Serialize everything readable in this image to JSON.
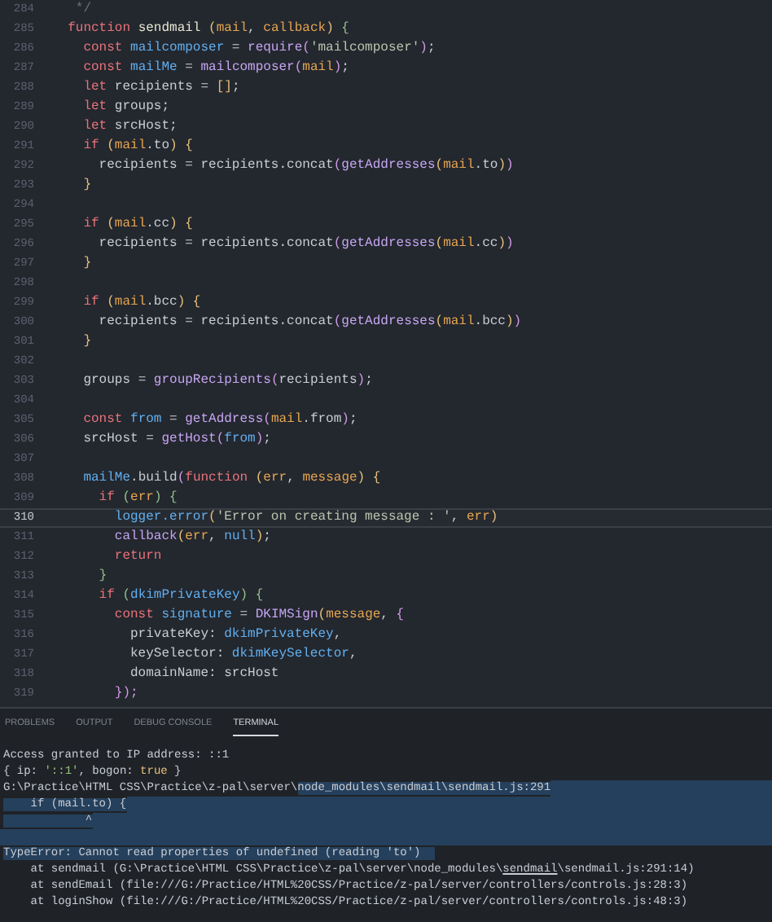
{
  "editor": {
    "lines": [
      {
        "number": "284",
        "current": false,
        "tokens": [
          {
            "text": "   */",
            "kind": "comment"
          }
        ]
      },
      {
        "number": "285",
        "current": false,
        "tokens": [
          {
            "text": "  function ",
            "kind": "kw"
          },
          {
            "text": "sendmail ",
            "kind": "fn"
          },
          {
            "text": "(",
            "kind": "b1"
          },
          {
            "text": "mail",
            "kind": "param"
          },
          {
            "text": ", ",
            "kind": "plain"
          },
          {
            "text": "callback",
            "kind": "param"
          },
          {
            "text": ") ",
            "kind": "b1"
          },
          {
            "text": "{",
            "kind": "b3"
          }
        ]
      },
      {
        "number": "286",
        "current": false,
        "tokens": [
          {
            "text": "    const ",
            "kind": "kw"
          },
          {
            "text": "mailcomposer",
            "kind": "var"
          },
          {
            "text": " = ",
            "kind": "op"
          },
          {
            "text": "require",
            "kind": "call"
          },
          {
            "text": "(",
            "kind": "b2"
          },
          {
            "text": "'mailcomposer'",
            "kind": "str"
          },
          {
            "text": ")",
            "kind": "b2"
          },
          {
            "text": ";",
            "kind": "plain"
          }
        ]
      },
      {
        "number": "287",
        "current": false,
        "tokens": [
          {
            "text": "    const ",
            "kind": "kw"
          },
          {
            "text": "mailMe",
            "kind": "var"
          },
          {
            "text": " = ",
            "kind": "op"
          },
          {
            "text": "mailcomposer",
            "kind": "call"
          },
          {
            "text": "(",
            "kind": "b2"
          },
          {
            "text": "mail",
            "kind": "param"
          },
          {
            "text": ")",
            "kind": "b2"
          },
          {
            "text": ";",
            "kind": "plain"
          }
        ]
      },
      {
        "number": "288",
        "current": false,
        "tokens": [
          {
            "text": "    let ",
            "kind": "kw"
          },
          {
            "text": "recipients",
            "kind": "plain"
          },
          {
            "text": " = ",
            "kind": "op"
          },
          {
            "text": "[]",
            "kind": "b1"
          },
          {
            "text": ";",
            "kind": "plain"
          }
        ]
      },
      {
        "number": "289",
        "current": false,
        "tokens": [
          {
            "text": "    let ",
            "kind": "kw"
          },
          {
            "text": "groups;",
            "kind": "plain"
          }
        ]
      },
      {
        "number": "290",
        "current": false,
        "tokens": [
          {
            "text": "    let ",
            "kind": "kw"
          },
          {
            "text": "srcHost;",
            "kind": "plain"
          }
        ]
      },
      {
        "number": "291",
        "current": false,
        "tokens": [
          {
            "text": "    if ",
            "kind": "kw"
          },
          {
            "text": "(",
            "kind": "b1"
          },
          {
            "text": "mail",
            "kind": "param"
          },
          {
            "text": ".to",
            "kind": "plain"
          },
          {
            "text": ") {",
            "kind": "b1"
          }
        ]
      },
      {
        "number": "292",
        "current": false,
        "tokens": [
          {
            "text": "      recipients",
            "kind": "plain"
          },
          {
            "text": " = ",
            "kind": "op"
          },
          {
            "text": "recipients.concat",
            "kind": "plain"
          },
          {
            "text": "(",
            "kind": "b2"
          },
          {
            "text": "getAddresses",
            "kind": "call"
          },
          {
            "text": "(",
            "kind": "b1"
          },
          {
            "text": "mail",
            "kind": "param"
          },
          {
            "text": ".to",
            "kind": "plain"
          },
          {
            "text": ")",
            "kind": "b1"
          },
          {
            "text": ")",
            "kind": "b2"
          }
        ]
      },
      {
        "number": "293",
        "current": false,
        "tokens": [
          {
            "text": "    }",
            "kind": "b1"
          }
        ]
      },
      {
        "number": "294",
        "current": false
      },
      {
        "number": "295",
        "current": false,
        "tokens": [
          {
            "text": "    if ",
            "kind": "kw"
          },
          {
            "text": "(",
            "kind": "b1"
          },
          {
            "text": "mail",
            "kind": "param"
          },
          {
            "text": ".cc",
            "kind": "plain"
          },
          {
            "text": ") {",
            "kind": "b1"
          }
        ]
      },
      {
        "number": "296",
        "current": false,
        "tokens": [
          {
            "text": "      recipients",
            "kind": "plain"
          },
          {
            "text": " = ",
            "kind": "op"
          },
          {
            "text": "recipients.concat",
            "kind": "plain"
          },
          {
            "text": "(",
            "kind": "b2"
          },
          {
            "text": "getAddresses",
            "kind": "call"
          },
          {
            "text": "(",
            "kind": "b1"
          },
          {
            "text": "mail",
            "kind": "param"
          },
          {
            "text": ".cc",
            "kind": "plain"
          },
          {
            "text": ")",
            "kind": "b1"
          },
          {
            "text": ")",
            "kind": "b2"
          }
        ]
      },
      {
        "number": "297",
        "current": false,
        "tokens": [
          {
            "text": "    }",
            "kind": "b1"
          }
        ]
      },
      {
        "number": "298",
        "current": false
      },
      {
        "number": "299",
        "current": false,
        "tokens": [
          {
            "text": "    if ",
            "kind": "kw"
          },
          {
            "text": "(",
            "kind": "b1"
          },
          {
            "text": "mail",
            "kind": "param"
          },
          {
            "text": ".bcc",
            "kind": "plain"
          },
          {
            "text": ") {",
            "kind": "b1"
          }
        ]
      },
      {
        "number": "300",
        "current": false,
        "tokens": [
          {
            "text": "      recipients",
            "kind": "plain"
          },
          {
            "text": " = ",
            "kind": "op"
          },
          {
            "text": "recipients.concat",
            "kind": "plain"
          },
          {
            "text": "(",
            "kind": "b2"
          },
          {
            "text": "getAddresses",
            "kind": "call"
          },
          {
            "text": "(",
            "kind": "b1"
          },
          {
            "text": "mail",
            "kind": "param"
          },
          {
            "text": ".bcc",
            "kind": "plain"
          },
          {
            "text": ")",
            "kind": "b1"
          },
          {
            "text": ")",
            "kind": "b2"
          }
        ]
      },
      {
        "number": "301",
        "current": false,
        "tokens": [
          {
            "text": "    }",
            "kind": "b1"
          }
        ]
      },
      {
        "number": "302",
        "current": false
      },
      {
        "number": "303",
        "current": false,
        "tokens": [
          {
            "text": "    groups",
            "kind": "plain"
          },
          {
            "text": " = ",
            "kind": "op"
          },
          {
            "text": "groupRecipients",
            "kind": "call"
          },
          {
            "text": "(",
            "kind": "b2"
          },
          {
            "text": "recipients",
            "kind": "plain"
          },
          {
            "text": ")",
            "kind": "b2"
          },
          {
            "text": ";",
            "kind": "plain"
          }
        ]
      },
      {
        "number": "304",
        "current": false
      },
      {
        "number": "305",
        "current": false,
        "tokens": [
          {
            "text": "    const ",
            "kind": "kw"
          },
          {
            "text": "from",
            "kind": "var"
          },
          {
            "text": " = ",
            "kind": "op"
          },
          {
            "text": "getAddress",
            "kind": "call"
          },
          {
            "text": "(",
            "kind": "b2"
          },
          {
            "text": "mail",
            "kind": "param"
          },
          {
            "text": ".from",
            "kind": "plain"
          },
          {
            "text": ")",
            "kind": "b2"
          },
          {
            "text": ";",
            "kind": "plain"
          }
        ]
      },
      {
        "number": "306",
        "current": false,
        "tokens": [
          {
            "text": "    srcHost",
            "kind": "plain"
          },
          {
            "text": " = ",
            "kind": "op"
          },
          {
            "text": "getHost",
            "kind": "call"
          },
          {
            "text": "(",
            "kind": "b2"
          },
          {
            "text": "from",
            "kind": "var"
          },
          {
            "text": ")",
            "kind": "b2"
          },
          {
            "text": ";",
            "kind": "plain"
          }
        ]
      },
      {
        "number": "307",
        "current": false
      },
      {
        "number": "308",
        "current": false,
        "tokens": [
          {
            "text": "    mailMe",
            "kind": "var"
          },
          {
            "text": ".build",
            "kind": "plain"
          },
          {
            "text": "(",
            "kind": "b2"
          },
          {
            "text": "function ",
            "kind": "kw"
          },
          {
            "text": "(",
            "kind": "b1"
          },
          {
            "text": "err",
            "kind": "param"
          },
          {
            "text": ", ",
            "kind": "plain"
          },
          {
            "text": "message",
            "kind": "param"
          },
          {
            "text": ") {",
            "kind": "b1"
          }
        ]
      },
      {
        "number": "309",
        "current": false,
        "tokens": [
          {
            "text": "      if ",
            "kind": "kw"
          },
          {
            "text": "(",
            "kind": "b3"
          },
          {
            "text": "err",
            "kind": "param"
          },
          {
            "text": ") {",
            "kind": "b3"
          }
        ]
      },
      {
        "number": "310",
        "current": true,
        "tokens": [
          {
            "text": "        logger.error",
            "kind": "var"
          },
          {
            "text": "(",
            "kind": "b1"
          },
          {
            "text": "'Error on creating message : '",
            "kind": "str"
          },
          {
            "text": ", ",
            "kind": "plain"
          },
          {
            "text": "err",
            "kind": "param"
          },
          {
            "text": ")",
            "kind": "b1"
          }
        ]
      },
      {
        "number": "311",
        "current": false,
        "tokens": [
          {
            "text": "        callback",
            "kind": "call"
          },
          {
            "text": "(",
            "kind": "b1"
          },
          {
            "text": "err",
            "kind": "param"
          },
          {
            "text": ", ",
            "kind": "plain"
          },
          {
            "text": "null",
            "kind": "var"
          },
          {
            "text": ")",
            "kind": "b1"
          },
          {
            "text": ";",
            "kind": "plain"
          }
        ]
      },
      {
        "number": "312",
        "current": false,
        "tokens": [
          {
            "text": "        return",
            "kind": "kw"
          }
        ]
      },
      {
        "number": "313",
        "current": false,
        "tokens": [
          {
            "text": "      }",
            "kind": "b3"
          }
        ]
      },
      {
        "number": "314",
        "current": false,
        "tokens": [
          {
            "text": "      if ",
            "kind": "kw"
          },
          {
            "text": "(",
            "kind": "b3"
          },
          {
            "text": "dkimPrivateKey",
            "kind": "var"
          },
          {
            "text": ") {",
            "kind": "b3"
          }
        ]
      },
      {
        "number": "315",
        "current": false,
        "tokens": [
          {
            "text": "        const ",
            "kind": "kw"
          },
          {
            "text": "signature",
            "kind": "var"
          },
          {
            "text": " = ",
            "kind": "op"
          },
          {
            "text": "DKIMSign",
            "kind": "call"
          },
          {
            "text": "(",
            "kind": "b1"
          },
          {
            "text": "message",
            "kind": "param"
          },
          {
            "text": ", ",
            "kind": "plain"
          },
          {
            "text": "{",
            "kind": "b2"
          }
        ]
      },
      {
        "number": "316",
        "current": false,
        "tokens": [
          {
            "text": "          privateKey: ",
            "kind": "plain"
          },
          {
            "text": "dkimPrivateKey",
            "kind": "var"
          },
          {
            "text": ",",
            "kind": "plain"
          }
        ]
      },
      {
        "number": "317",
        "current": false,
        "tokens": [
          {
            "text": "          keySelector: ",
            "kind": "plain"
          },
          {
            "text": "dkimKeySelector",
            "kind": "var"
          },
          {
            "text": ",",
            "kind": "plain"
          }
        ]
      },
      {
        "number": "318",
        "current": false,
        "tokens": [
          {
            "text": "          domainName: srcHost",
            "kind": "plain"
          }
        ]
      },
      {
        "number": "319",
        "current": false,
        "tokens": [
          {
            "text": "        });",
            "kind": "b2"
          }
        ]
      }
    ]
  },
  "panel": {
    "tabs": [
      {
        "label": "PROBLEMS",
        "selected": false
      },
      {
        "label": "OUTPUT",
        "selected": false
      },
      {
        "label": "DEBUG CONSOLE",
        "selected": false
      },
      {
        "label": "TERMINAL",
        "selected": true
      }
    ],
    "terminal": {
      "lines": [
        {
          "fill_selected": false,
          "segments": [
            {
              "text": "Access granted to IP address: ::1",
              "kind": "plain",
              "selected": false
            }
          ]
        },
        {
          "fill_selected": false,
          "segments": [
            {
              "text": "{ ip: ",
              "kind": "plain",
              "selected": false
            },
            {
              "text": "'::1'",
              "kind": "string",
              "selected": false
            },
            {
              "text": ", bogon: ",
              "kind": "plain",
              "selected": false
            },
            {
              "text": "true",
              "kind": "keyword",
              "selected": false
            },
            {
              "text": " }",
              "kind": "plain",
              "selected": false
            }
          ]
        },
        {
          "fill_selected": true,
          "segments": [
            {
              "text": "G:\\Practice\\HTML CSS\\Practice\\z-pal\\server\\",
              "kind": "plain",
              "selected": false
            },
            {
              "text": "node_modules\\sendmail\\sendmail.js:291",
              "kind": "plain",
              "selected": true
            }
          ]
        },
        {
          "fill_selected": true,
          "segments": [
            {
              "text": "    if (mail.to) {",
              "kind": "plain",
              "selected": true
            }
          ]
        },
        {
          "fill_selected": true,
          "segments": [
            {
              "text": "            ^",
              "kind": "plain",
              "selected": true
            }
          ]
        },
        {
          "fill_selected": true
        },
        {
          "fill_selected": false,
          "segments": [
            {
              "text": "TypeError: Cannot read properties of undefined (reading 'to')  ",
              "kind": "plain",
              "selected": true
            }
          ]
        },
        {
          "fill_selected": false,
          "segments": [
            {
              "text": "    at sendmail (G:\\Practice\\HTML CSS\\Practice\\z-pal\\server\\node_modules\\",
              "kind": "plain",
              "selected": false
            },
            {
              "text": "sendmail",
              "kind": "link",
              "selected": false
            },
            {
              "text": "\\sendmail.js:291:14)",
              "kind": "plain",
              "selected": false
            }
          ]
        },
        {
          "fill_selected": false,
          "segments": [
            {
              "text": "    at sendEmail (file:///G:/Practice/HTML%20CSS/Practice/z-pal/server/controllers/controls.js:28:3)",
              "kind": "plain",
              "selected": false
            }
          ]
        },
        {
          "fill_selected": false,
          "segments": [
            {
              "text": "    at loginShow (file:///G:/Practice/HTML%20CSS/Practice/z-pal/server/controllers/controls.js:48:3)",
              "kind": "plain",
              "selected": false
            }
          ]
        }
      ]
    }
  }
}
